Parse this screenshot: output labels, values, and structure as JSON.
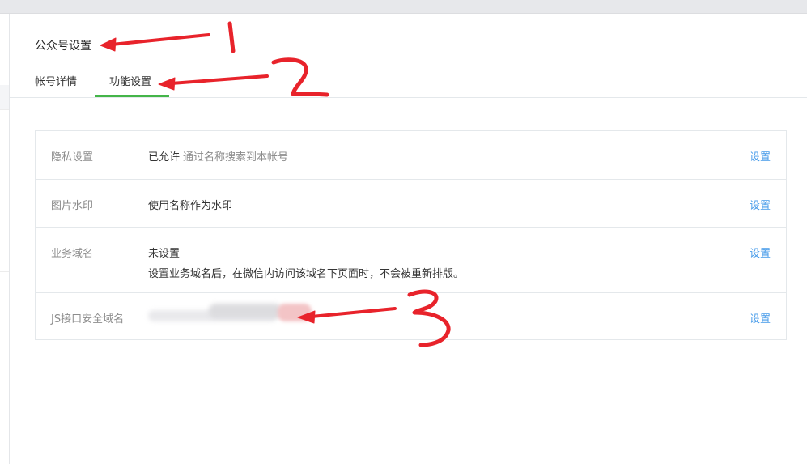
{
  "page": {
    "title": "公众号设置"
  },
  "tabs": [
    {
      "label": "帐号详情",
      "active": false
    },
    {
      "label": "功能设置",
      "active": true
    }
  ],
  "settings": [
    {
      "label": "隐私设置",
      "value": "已允许",
      "detail": "通过名称搜索到本帐号",
      "action": "设置"
    },
    {
      "label": "图片水印",
      "value": "使用名称作为水印",
      "action": "设置"
    },
    {
      "label": "业务域名",
      "value": "未设置",
      "description": "设置业务域名后，在微信内访问该域名下页面时，不会被重新排版。",
      "action": "设置"
    },
    {
      "label": "JS接口安全域名",
      "value_redacted": true,
      "action": "设置"
    }
  ],
  "annotations": [
    "1",
    "2",
    "3"
  ],
  "colors": {
    "accent_green": "#44b549",
    "link_blue": "#459ae9",
    "annotation_red": "#e8232b"
  }
}
